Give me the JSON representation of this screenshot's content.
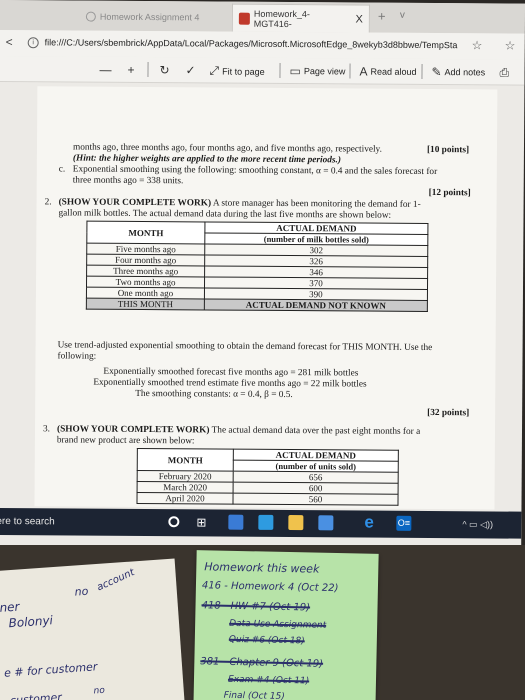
{
  "browser": {
    "tab_inactive": "Homework Assignment 4",
    "tab_active": "Homework_4-MGT416-",
    "tab_close": "X",
    "tab_new": "+",
    "tab_list": "v",
    "back": "<",
    "url": "file:///C:/Users/sbembrick/AppData/Local/Packages/Microsoft.MicrosoftEdge_8wekyb3d8bbwe/TempSta",
    "star": "☆",
    "favorites": "☆"
  },
  "pdf_toolbar": {
    "zoom_out": "—",
    "zoom_in": "+",
    "rotate": "↻",
    "draw": "✓",
    "fit_to_page": "Fit to page",
    "page_view": "Page view",
    "read_aloud": "Read aloud",
    "add_notes": "Add notes",
    "print": "⎙"
  },
  "document": {
    "line1": "months ago, three months ago, four months ago, and five months ago, respectively.",
    "line1_points": "[10 points]",
    "line2": "(Hint: the higher weights are applied to the more recent time periods.)",
    "item_c_label": "c.",
    "item_c_line1": "Exponential smoothing using the following: smoothing constant, α = 0.4 and the sales forecast for",
    "item_c_line2": "three months ago = 338 units.",
    "item_c_points": "[12 points]",
    "q2_number": "2.",
    "q2_line1_bold": "(SHOW YOUR COMPLETE WORK)",
    "q2_line1_rest": "A store manager has been monitoring the demand for 1-",
    "q2_line2": "gallon milk bottles. The actual demand data during the last five months are shown below:",
    "table1": {
      "head_month": "MONTH",
      "head_demand_1": "ACTUAL DEMAND",
      "head_demand_2": "(number of milk bottles sold)",
      "rows": [
        {
          "month": "Five months ago",
          "demand": "302"
        },
        {
          "month": "Four months ago",
          "demand": "326"
        },
        {
          "month": "Three months ago",
          "demand": "346"
        },
        {
          "month": "Two months ago",
          "demand": "370"
        },
        {
          "month": "One month ago",
          "demand": "390"
        }
      ],
      "last_month": "THIS MONTH",
      "last_demand": "ACTUAL DEMAND NOT KNOWN"
    },
    "q2_use_line1": "Use trend-adjusted exponential smoothing to obtain the demand forecast for THIS MONTH. Use the",
    "q2_use_line2": "following:",
    "q2_given1": "Exponentially smoothed forecast five months ago = 281 milk bottles",
    "q2_given2": "Exponentially smoothed trend estimate five months ago = 22 milk bottles",
    "q2_given3": "The smoothing constants: α = 0.4, β = 0.5.",
    "q2_points": "[32 points]",
    "q3_number": "3.",
    "q3_line1_bold": "(SHOW YOUR COMPLETE WORK)",
    "q3_line1_rest": "The actual demand data over the past eight months for a",
    "q3_line2": "brand new product are shown below:",
    "table2": {
      "head_month": "MONTH",
      "head_demand_1": "ACTUAL DEMAND",
      "head_demand_2": "(number of units sold)",
      "rows": [
        {
          "month": "February 2020",
          "demand": "656"
        },
        {
          "month": "March 2020",
          "demand": "600"
        },
        {
          "month": "April 2020",
          "demand": "560"
        }
      ]
    }
  },
  "taskbar": {
    "search": "ere to search",
    "taskview": "⊞",
    "edge": "e",
    "office": "O≡",
    "tray": "^ ▭ ◁))"
  },
  "notes_left": {
    "l1": "ner",
    "l2": "no",
    "l3": "account",
    "l4": "Bolonyi",
    "l5": "e # for customer",
    "l6": "customer",
    "l7": "no"
  },
  "sticky_note": {
    "title": "Homework this week",
    "l1": "416 - Homework 4 (Oct 22)",
    "l2": "418 - HW #7 (Oct 19)",
    "l3": "Data Use Assignment",
    "l4": "Quiz #6 (Oct 18)",
    "l5": "381 - Chapter 9 (Oct 19)",
    "l6": "Exam #4 (Oct 11)",
    "l7": "Final (Oct 15)"
  }
}
